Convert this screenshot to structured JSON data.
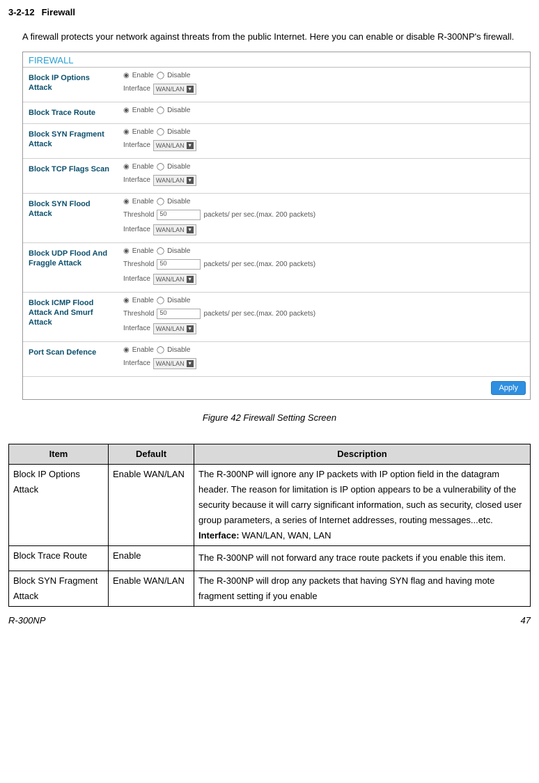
{
  "heading": {
    "num": "3-2-12",
    "title": "Firewall"
  },
  "intro": "A firewall protects your network against threats from the public Internet. Here you can enable or disable R-300NP's firewall.",
  "panel": {
    "title": "FIREWALL",
    "enable": "Enable",
    "disable": "Disable",
    "iface_label": "Interface",
    "iface_value": "WAN/LAN",
    "threshold_label": "Threshold",
    "threshold_value": "50",
    "threshold_unit": "packets/ per sec.(max. 200 packets)",
    "rows": {
      "r1": "Block IP Options Attack",
      "r2": "Block Trace Route",
      "r3": "Block SYN Fragment Attack",
      "r4": "Block TCP Flags Scan",
      "r5": "Block SYN Flood Attack",
      "r6": "Block UDP Flood And Fraggle Attack",
      "r7": "Block ICMP Flood Attack And Smurf Attack",
      "r8": "Port Scan Defence"
    },
    "apply": "Apply"
  },
  "figure_caption": "Figure 42 Firewall Setting Screen",
  "table": {
    "h1": "Item",
    "h2": "Default",
    "h3": "Description",
    "row1": {
      "item": "Block IP Options Attack",
      "def": "Enable WAN/LAN",
      "desc_main": "The R-300NP will ignore any IP packets with IP option field in the datagram header. The reason for limitation is IP option appears to be a vulnerability of the security because it will carry significant information, such as security, closed user group parameters, a series of Internet addresses, routing messages...etc.",
      "iface_label": "Interface:",
      "iface_vals": " WAN/LAN, WAN, LAN"
    },
    "row2": {
      "item": "Block Trace Route",
      "def": "Enable",
      "desc": "The R-300NP will not forward any trace route packets if you enable this item."
    },
    "row3": {
      "item": "Block SYN Fragment Attack",
      "def": "Enable WAN/LAN",
      "desc": "The R-300NP will drop any packets that having SYN flag and having mote fragment setting if you enable"
    }
  },
  "footer": {
    "left": "R-300NP",
    "right": "47"
  }
}
